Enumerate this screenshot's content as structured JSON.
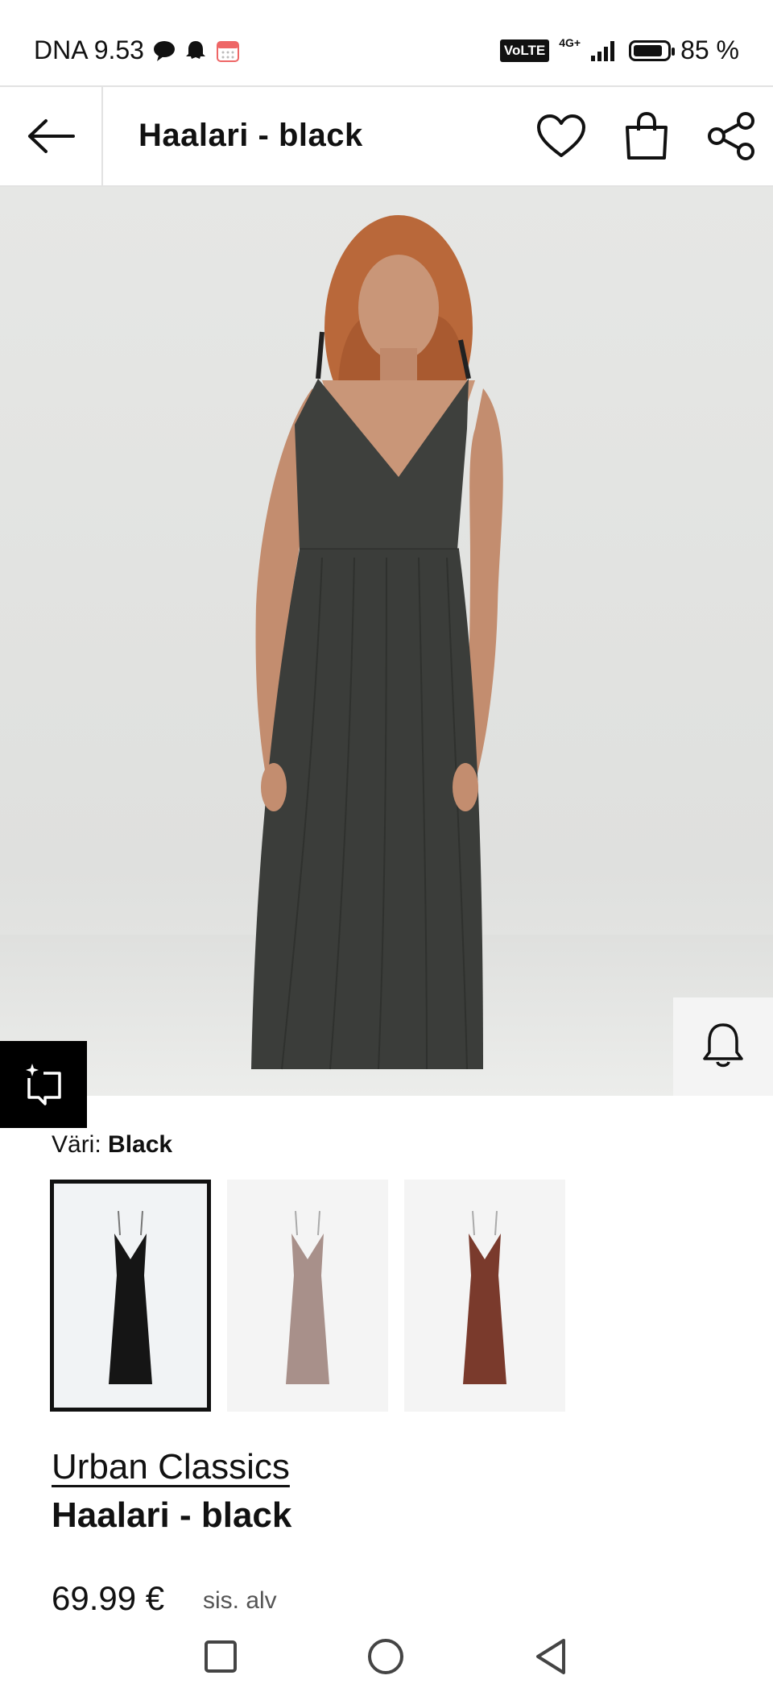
{
  "status_bar": {
    "carrier_time": "DNA 9.53",
    "network": "VoLTE",
    "signal": "4G+",
    "battery": "85 %",
    "battery_level": 0.85
  },
  "header": {
    "title": "Haalari - black"
  },
  "hero": {
    "description": "Model wearing black wide-leg jumpsuit"
  },
  "color": {
    "label": "Väri:",
    "value": "Black",
    "options": [
      {
        "name": "black",
        "color": "#151515",
        "selected": true
      },
      {
        "name": "taupe",
        "color": "#a8908a",
        "selected": false
      },
      {
        "name": "rust",
        "color": "#7a3a2c",
        "selected": false
      }
    ]
  },
  "product": {
    "brand": "Urban Classics",
    "name": "Haalari - black",
    "price": "69.99 €",
    "vat": "sis. alv"
  }
}
